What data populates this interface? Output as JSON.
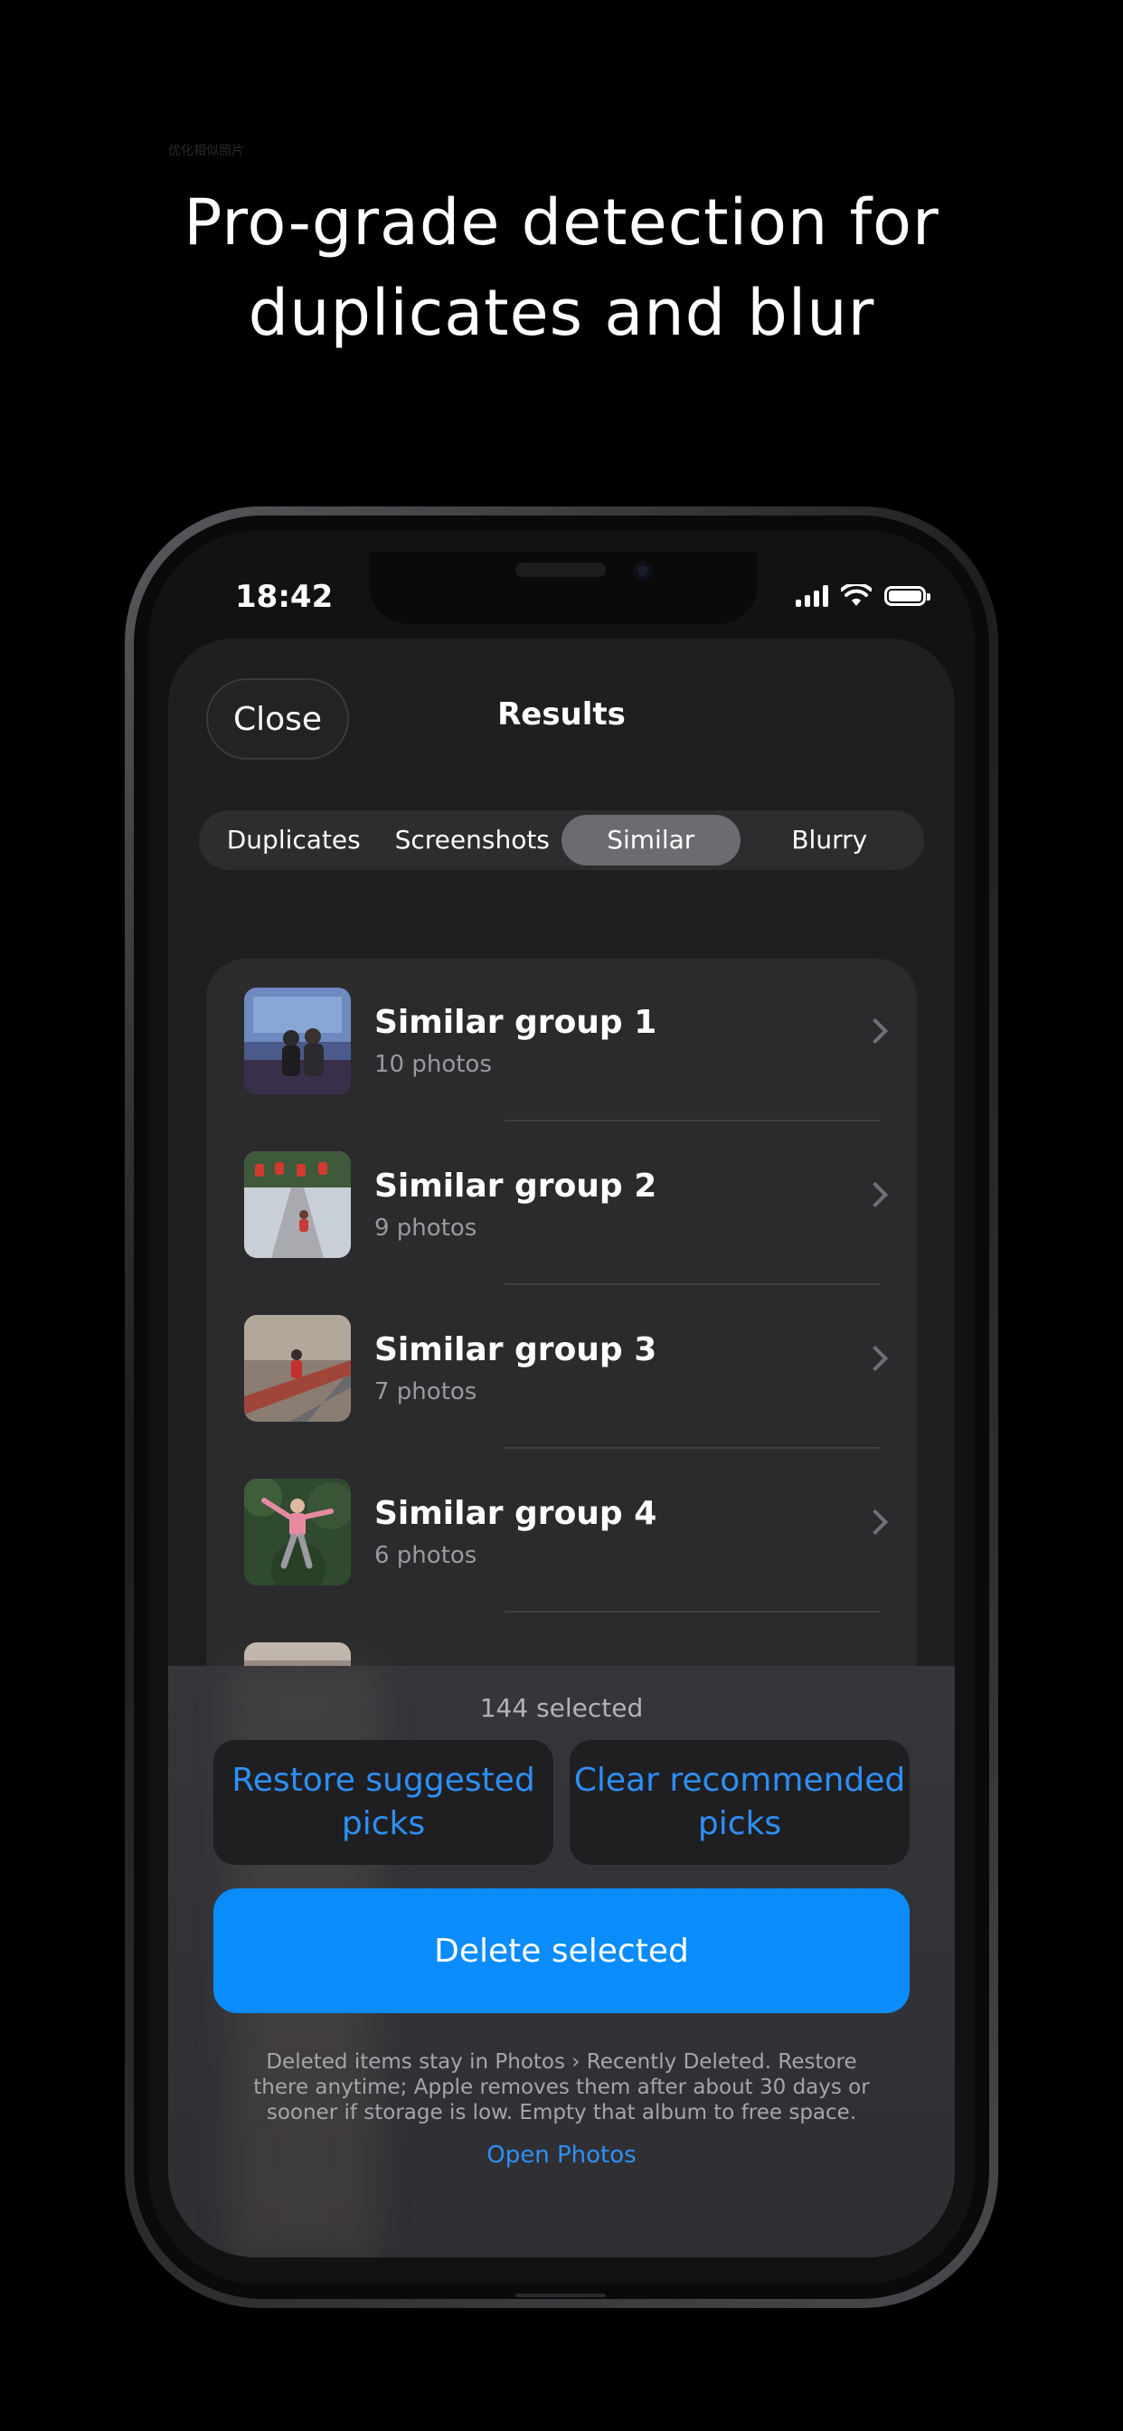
{
  "promo": {
    "small_note": "优化相似照片",
    "headline_line1": "Pro-grade detection for",
    "headline_line2": "duplicates and blur"
  },
  "status_bar": {
    "time": "18:42"
  },
  "nav": {
    "close_label": "Close",
    "title": "Results"
  },
  "tabs": [
    {
      "label": "Duplicates",
      "active": false
    },
    {
      "label": "Screenshots",
      "active": false
    },
    {
      "label": "Similar",
      "active": true
    },
    {
      "label": "Blurry",
      "active": false
    }
  ],
  "groups": [
    {
      "title": "Similar group 1",
      "subtitle": "10 photos"
    },
    {
      "title": "Similar group 2",
      "subtitle": "9 photos"
    },
    {
      "title": "Similar group 3",
      "subtitle": "7 photos"
    },
    {
      "title": "Similar group 4",
      "subtitle": "6 photos"
    }
  ],
  "sheet": {
    "selected_count": "144 selected",
    "restore_label": "Restore suggested picks",
    "clear_label": "Clear recommended picks",
    "delete_label": "Delete selected",
    "note": "Deleted items stay in Photos › Recently Deleted. Restore there anytime; Apple removes them after about 30 days or sooner if storage is low. Empty that album to free space.",
    "open_photos_label": "Open Photos"
  },
  "colors": {
    "accent": "#0a8cfd",
    "link": "#2e8ff6",
    "background": "#000000",
    "screen": "#1f1f21"
  }
}
